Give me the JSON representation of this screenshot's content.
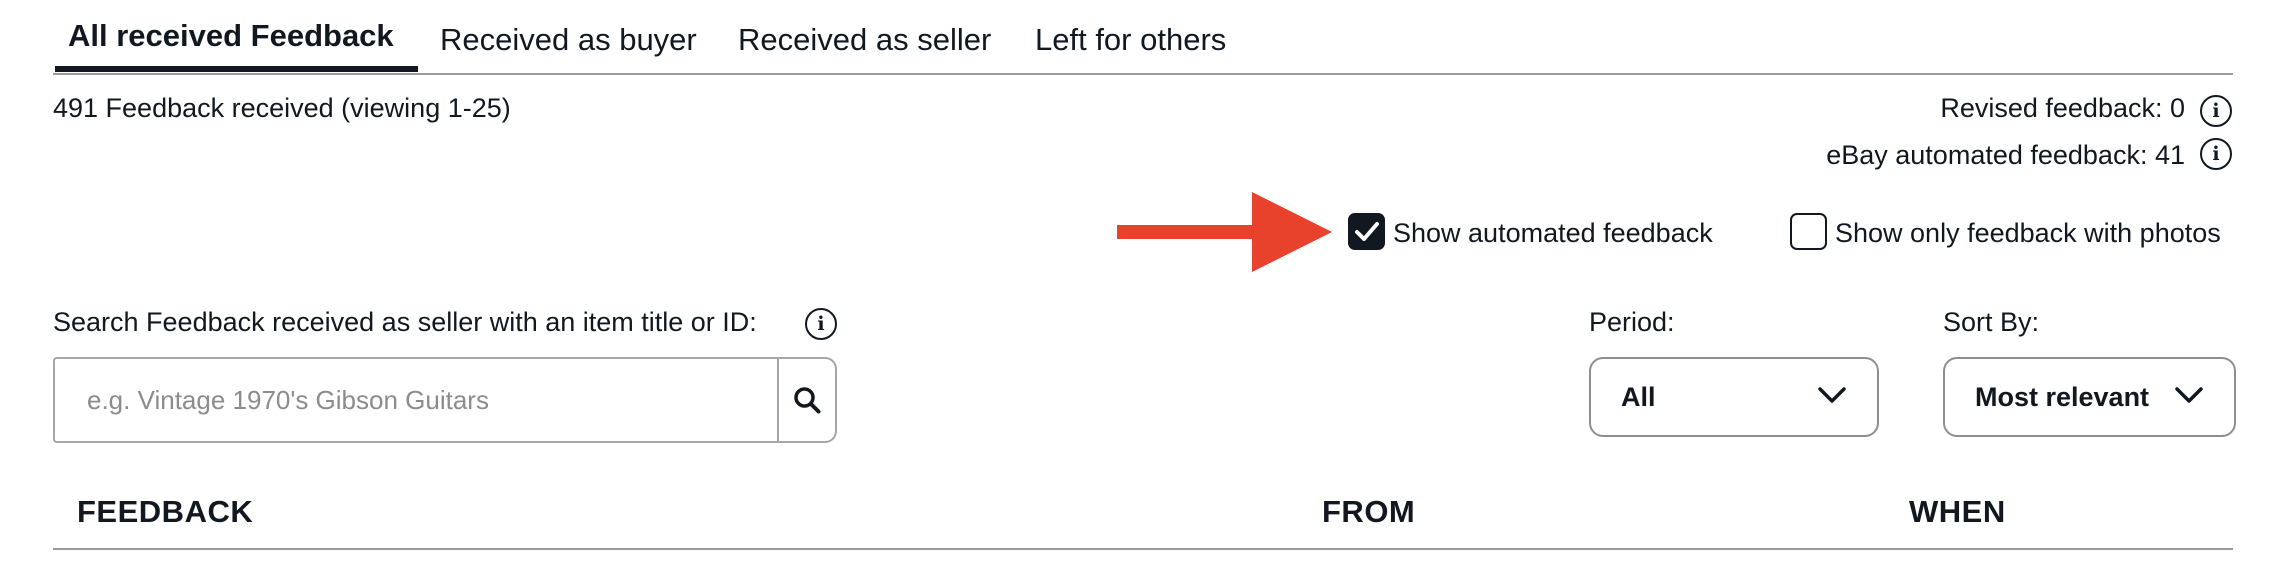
{
  "tabs": [
    {
      "label": "All received Feedback",
      "active": true
    },
    {
      "label": "Received as buyer",
      "active": false
    },
    {
      "label": "Received as seller",
      "active": false
    },
    {
      "label": "Left for others",
      "active": false
    }
  ],
  "summary": {
    "received_text": "491 Feedback received (viewing 1-25)",
    "revised_feedback": "Revised feedback: 0",
    "automated_feedback": "eBay automated feedback: 41"
  },
  "filters": {
    "show_automated_label": "Show automated feedback",
    "show_automated_checked": true,
    "show_photos_label": "Show only feedback with photos",
    "show_photos_checked": false
  },
  "search": {
    "label": "Search Feedback received as seller with an item title or ID:",
    "placeholder": "e.g. Vintage 1970's Gibson Guitars",
    "value": ""
  },
  "period": {
    "label": "Period:",
    "selected": "All"
  },
  "sort": {
    "label": "Sort By:",
    "selected": "Most relevant"
  },
  "table": {
    "columns": [
      "FEEDBACK",
      "FROM",
      "WHEN"
    ]
  },
  "colors": {
    "text": "#111820",
    "annotation_arrow": "#e8412c",
    "divider": "#9b9b9b"
  }
}
